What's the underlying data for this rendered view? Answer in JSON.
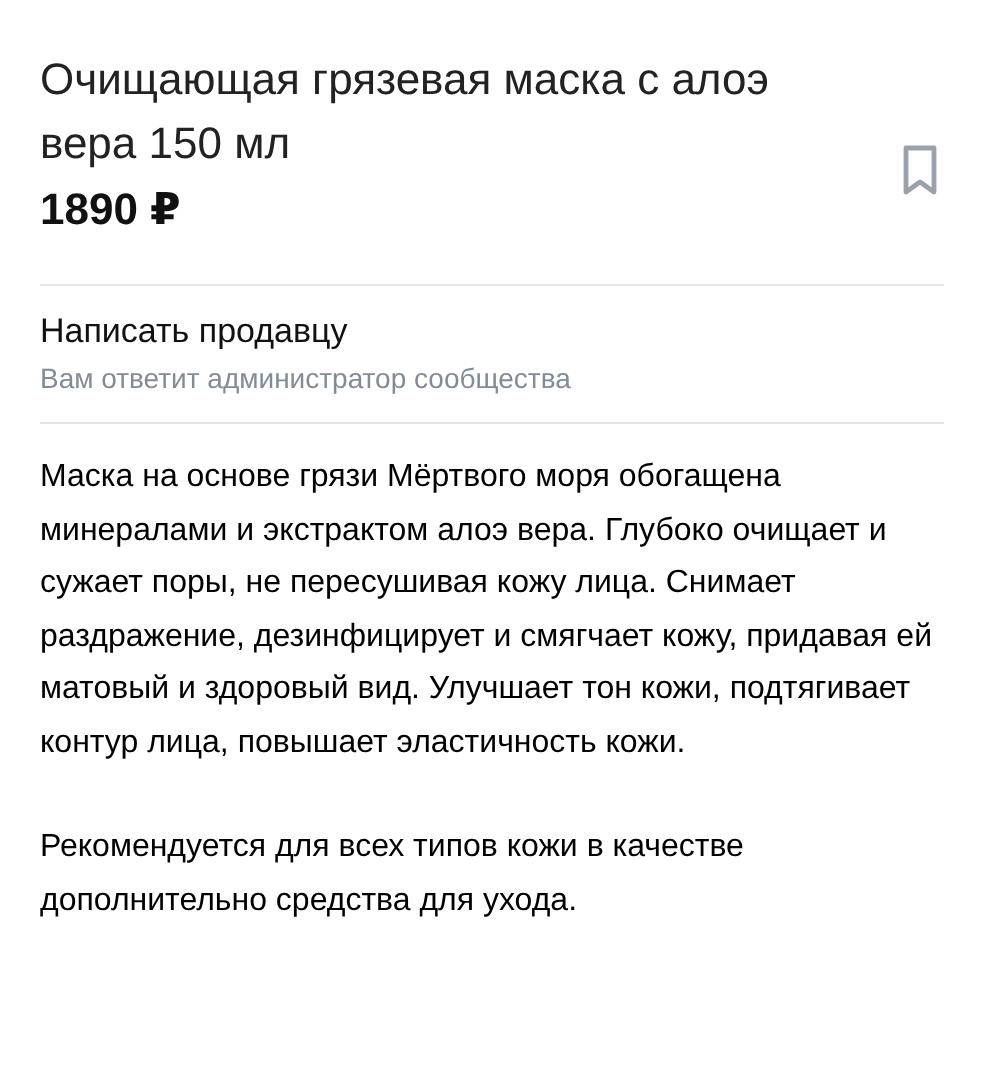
{
  "product": {
    "title": "Очищающая грязевая маска с алоэ вера 150 мл",
    "price": "1890 ₽",
    "bookmarked": false
  },
  "contact": {
    "title": "Написать продавцу",
    "subtitle": "Вам ответит администратор сообщества"
  },
  "description": [
    "Маска на основе грязи Мёртвого моря обогащена минералами и экстрактом алоэ вера. Глубоко очищает и сужает поры, не пересушивая кожу лица. Снимает раздражение, дезинфицирует и смягчает кожу, придавая ей матовый и здоровый вид. Улучшает тон кожи, подтягивает контур лица, повышает эластичность кожи.",
    "Рекомендуется для всех типов кожи в качестве дополнительно средства для ухода."
  ]
}
